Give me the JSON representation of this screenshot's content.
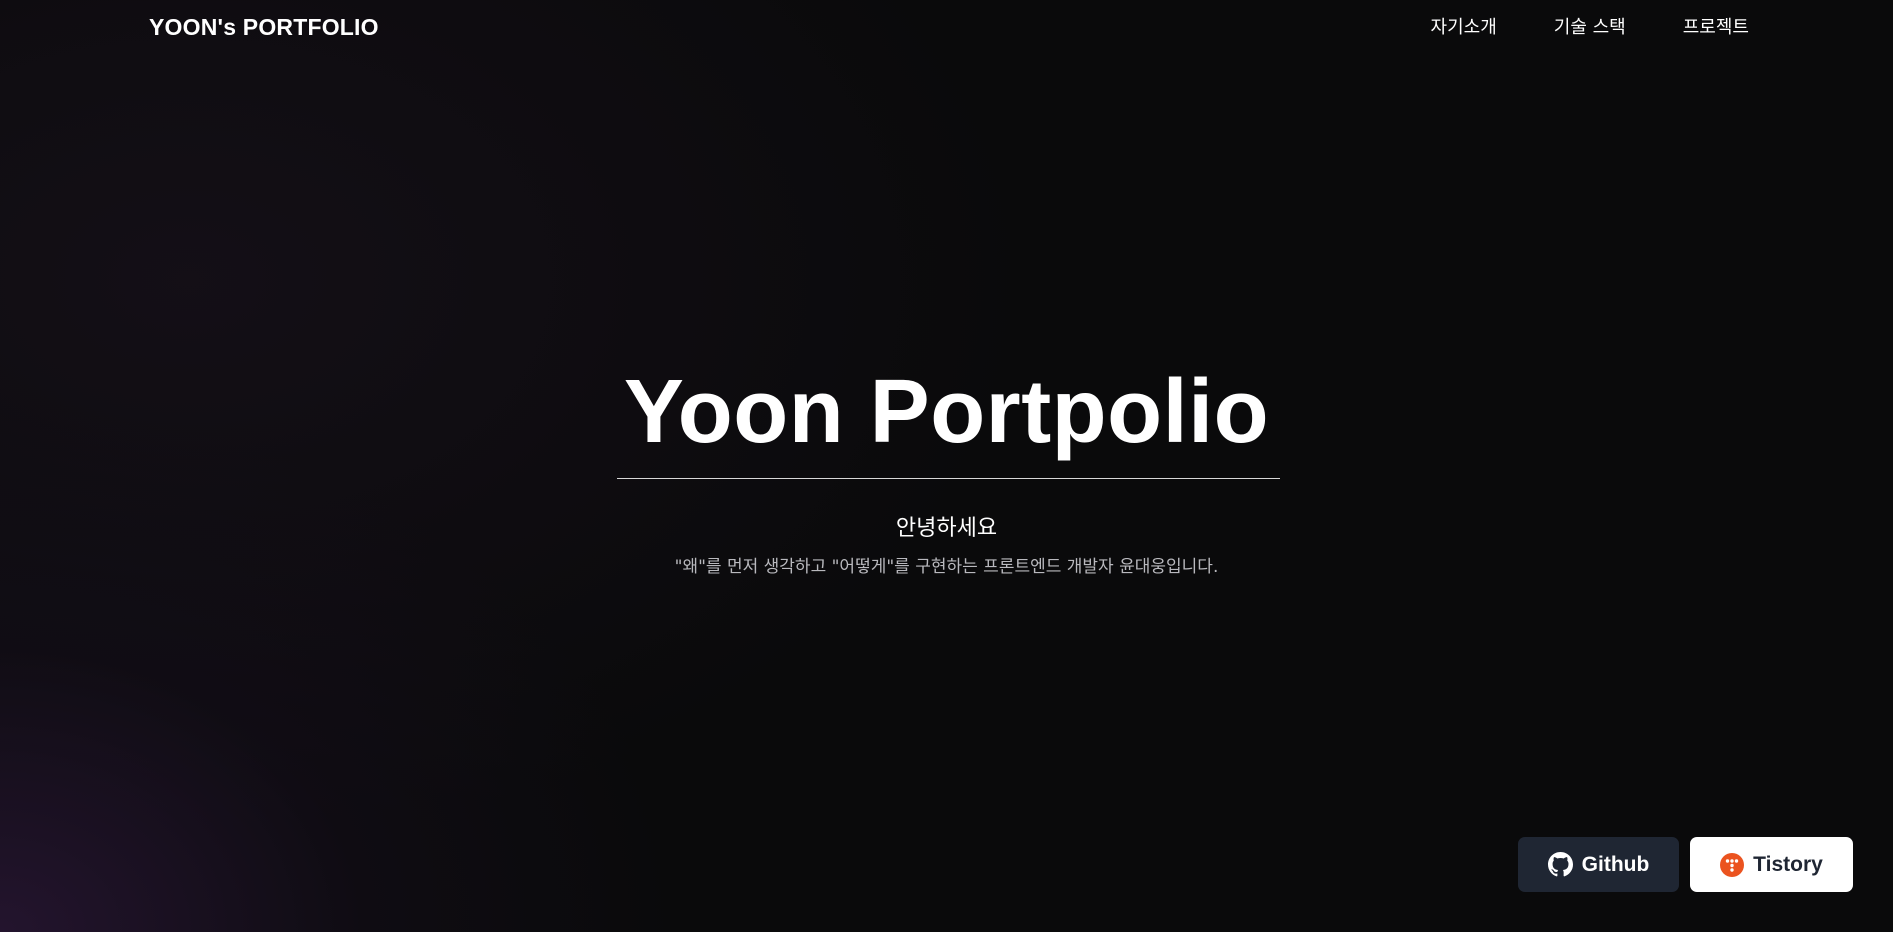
{
  "header": {
    "logo": "YOON's PORTFOLIO",
    "nav": [
      {
        "label": "자기소개"
      },
      {
        "label": "기술 스택"
      },
      {
        "label": "프로젝트"
      }
    ]
  },
  "hero": {
    "title": "Yoon Portpolio",
    "greeting": "안녕하세요",
    "description": "\"왜\"를 먼저 생각하고 \"어떻게\"를 구현하는 프론트엔드 개발자 윤대웅입니다."
  },
  "links": {
    "github": {
      "label": "Github",
      "icon": "github-icon"
    },
    "tistory": {
      "label": "Tistory",
      "icon": "tistory-icon"
    }
  },
  "colors": {
    "background": "#0a0a0b",
    "accent_purple": "#28163a",
    "github_button_bg": "#1f2633",
    "tistory_icon": "#eb531f"
  }
}
